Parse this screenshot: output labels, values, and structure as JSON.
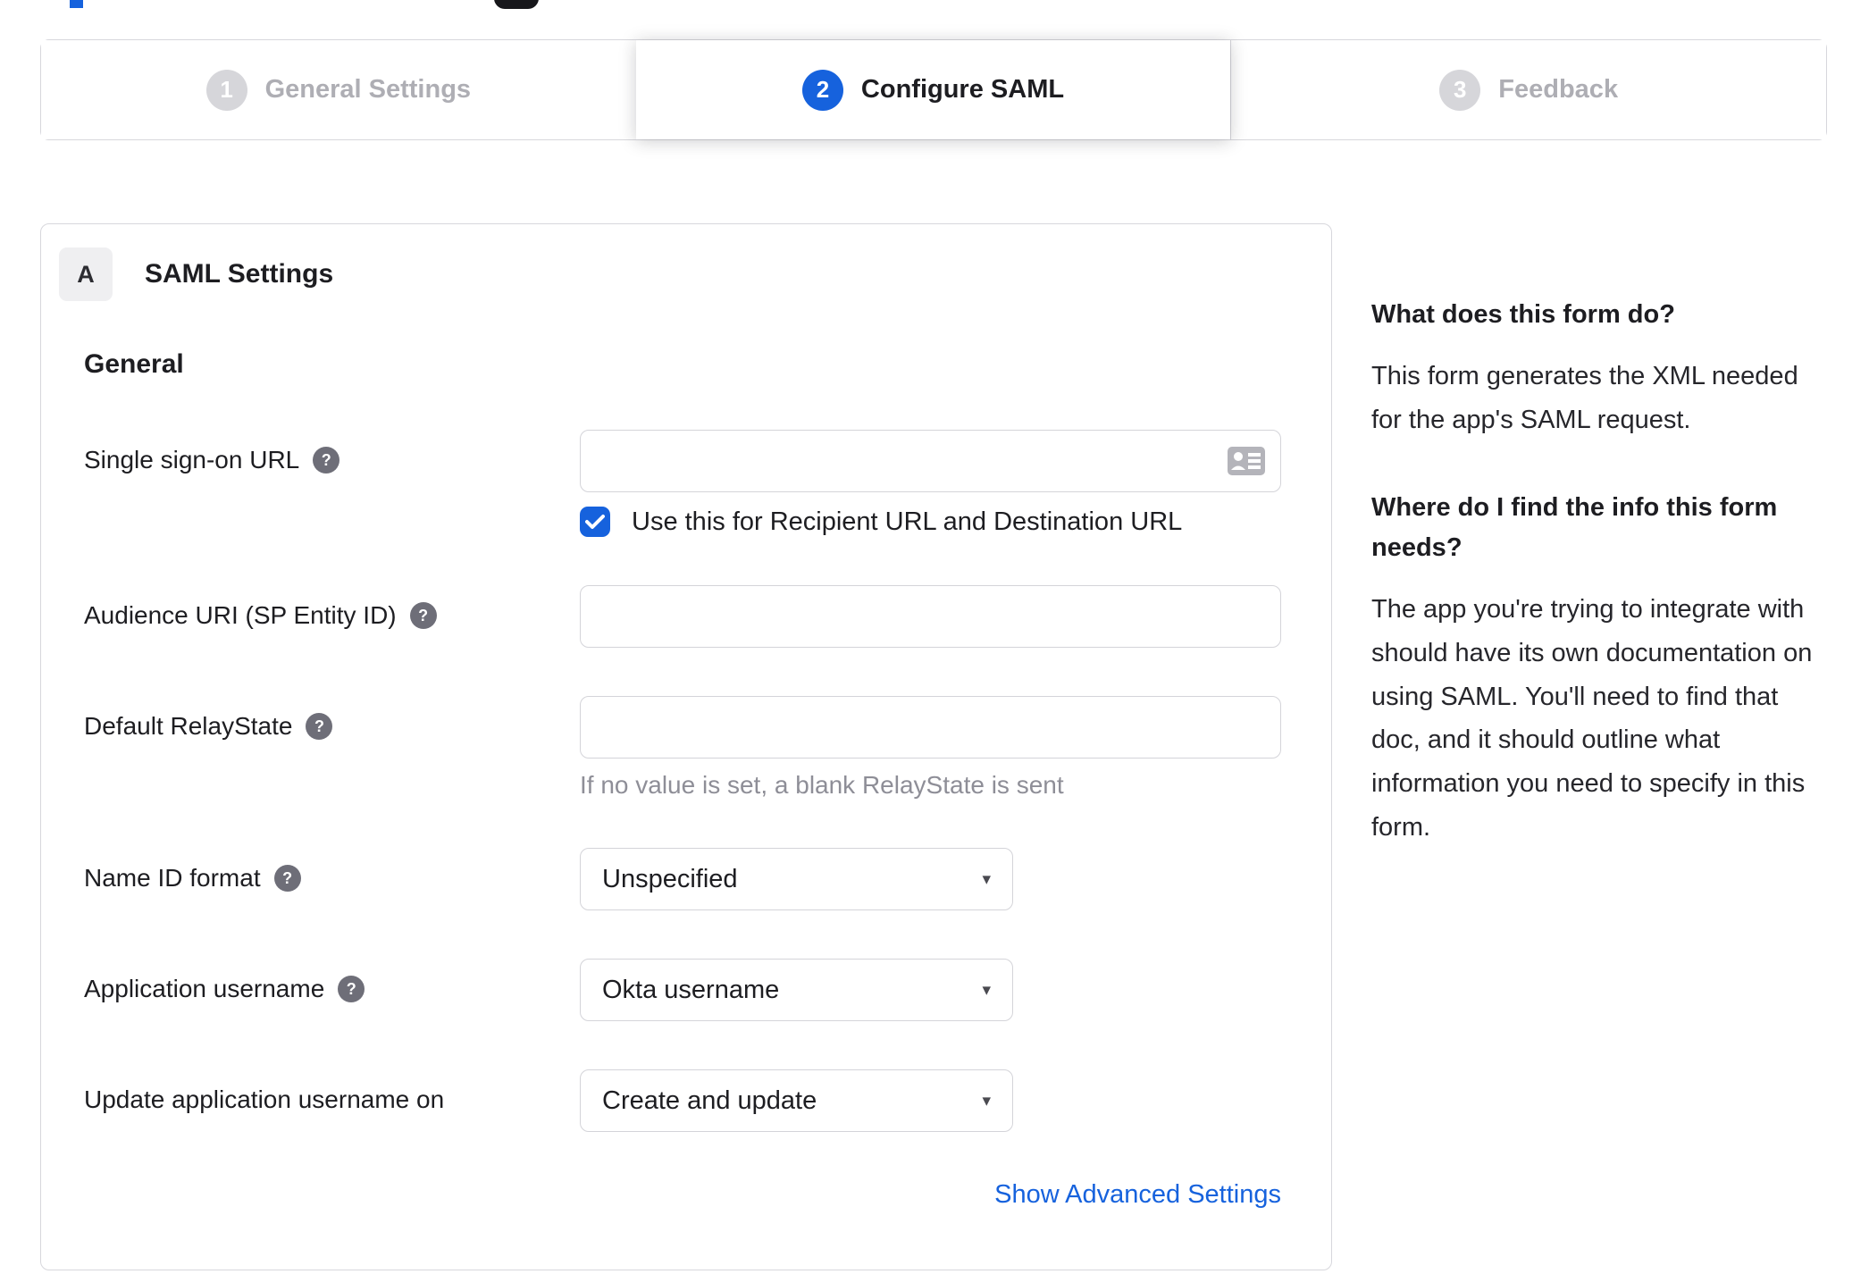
{
  "colors": {
    "accent_blue": "#1662dd",
    "inactive_gray": "#d6d6da",
    "border_gray": "#d7d7dc",
    "helper_gray": "#8e8e97",
    "help_icon_bg": "#6e6e78"
  },
  "icons": {
    "help_glyph": "?",
    "dropdown_glyph": "▾"
  },
  "stepper": {
    "steps": [
      {
        "number": "1",
        "label": "General Settings",
        "state": "inactive"
      },
      {
        "number": "2",
        "label": "Configure SAML",
        "state": "active"
      },
      {
        "number": "3",
        "label": "Feedback",
        "state": "inactive"
      }
    ]
  },
  "panel": {
    "section_badge": "A",
    "section_title": "SAML Settings",
    "group_heading": "General"
  },
  "form": {
    "sso": {
      "label": "Single sign-on URL",
      "value": "",
      "checkbox_label": "Use this for Recipient URL and Destination URL",
      "checkbox_checked": true
    },
    "audience": {
      "label": "Audience URI (SP Entity ID)",
      "value": ""
    },
    "relay": {
      "label": "Default RelayState",
      "value": "",
      "helper": "If no value is set, a blank RelayState is sent"
    },
    "name_id": {
      "label": "Name ID format",
      "value": "Unspecified"
    },
    "app_username": {
      "label": "Application username",
      "value": "Okta username"
    },
    "update_username": {
      "label": "Update application username on",
      "value": "Create and update"
    },
    "advanced_link": "Show Advanced Settings"
  },
  "sidebar": {
    "heading1": "What does this form do?",
    "para1": "This form generates the XML needed for the app's SAML request.",
    "heading2": "Where do I find the info this form needs?",
    "para2": "The app you're trying to integrate with should have its own documentation on using SAML. You'll need to find that doc, and it should outline what information you need to specify in this form."
  }
}
